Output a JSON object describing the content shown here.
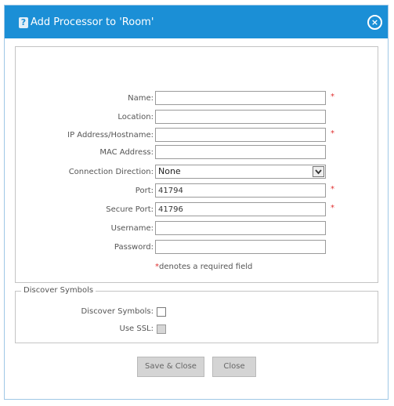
{
  "dialog": {
    "title": "Add Processor to 'Room'",
    "help_icon_glyph": "?",
    "close_glyph": "×",
    "accent_color": "#1b8fd6"
  },
  "form": {
    "fields": {
      "name": {
        "label": "Name:",
        "value": "",
        "required": true
      },
      "location": {
        "label": "Location:",
        "value": ""
      },
      "ip_address": {
        "label": "IP Address/Hostname:",
        "value": "",
        "required": true
      },
      "mac_address": {
        "label": "MAC Address:",
        "value": ""
      },
      "connection_direction": {
        "label": "Connection Direction:",
        "value": "None"
      },
      "port": {
        "label": "Port:",
        "value": "41794",
        "required": true
      },
      "secure_port": {
        "label": "Secure Port:",
        "value": "41796",
        "required": true
      },
      "username": {
        "label": "Username:",
        "value": ""
      },
      "password": {
        "label": "Password:",
        "value": ""
      }
    },
    "required_star": "*",
    "required_note": "denotes a required field"
  },
  "discover": {
    "legend": "Discover Symbols",
    "discover_symbols": {
      "label": "Discover Symbols:",
      "checked": false
    },
    "use_ssl": {
      "label": "Use SSL:",
      "checked": false,
      "disabled": true
    }
  },
  "buttons": {
    "save_close": "Save & Close",
    "close": "Close"
  }
}
